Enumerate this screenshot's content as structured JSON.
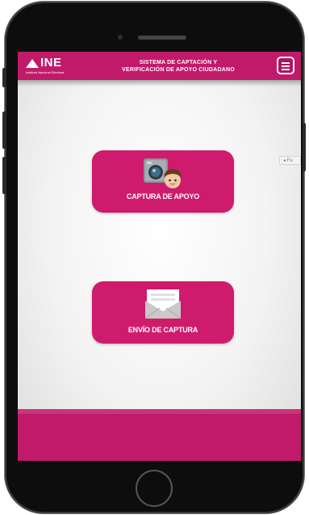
{
  "header": {
    "logo_text": "INE",
    "logo_subtext": "Instituto Nacional Electoral",
    "title_line1": "SISTEMA DE CAPTACIÓN Y",
    "title_line2": "VERIFICACIÓN DE APOYO CIUDADANO"
  },
  "main": {
    "tiles": [
      {
        "label": "CAPTURA DE APOYO",
        "icon": "camera-person-icon"
      },
      {
        "label": "ENVÍO DE CAPTURA",
        "icon": "envelope-icon"
      }
    ],
    "side_tab_text": "◂ Fu"
  },
  "colors": {
    "brand": "#c21a6b",
    "tile": "#cf1b6d",
    "background": "#f3f3f3",
    "device": "#0d0d0d"
  }
}
